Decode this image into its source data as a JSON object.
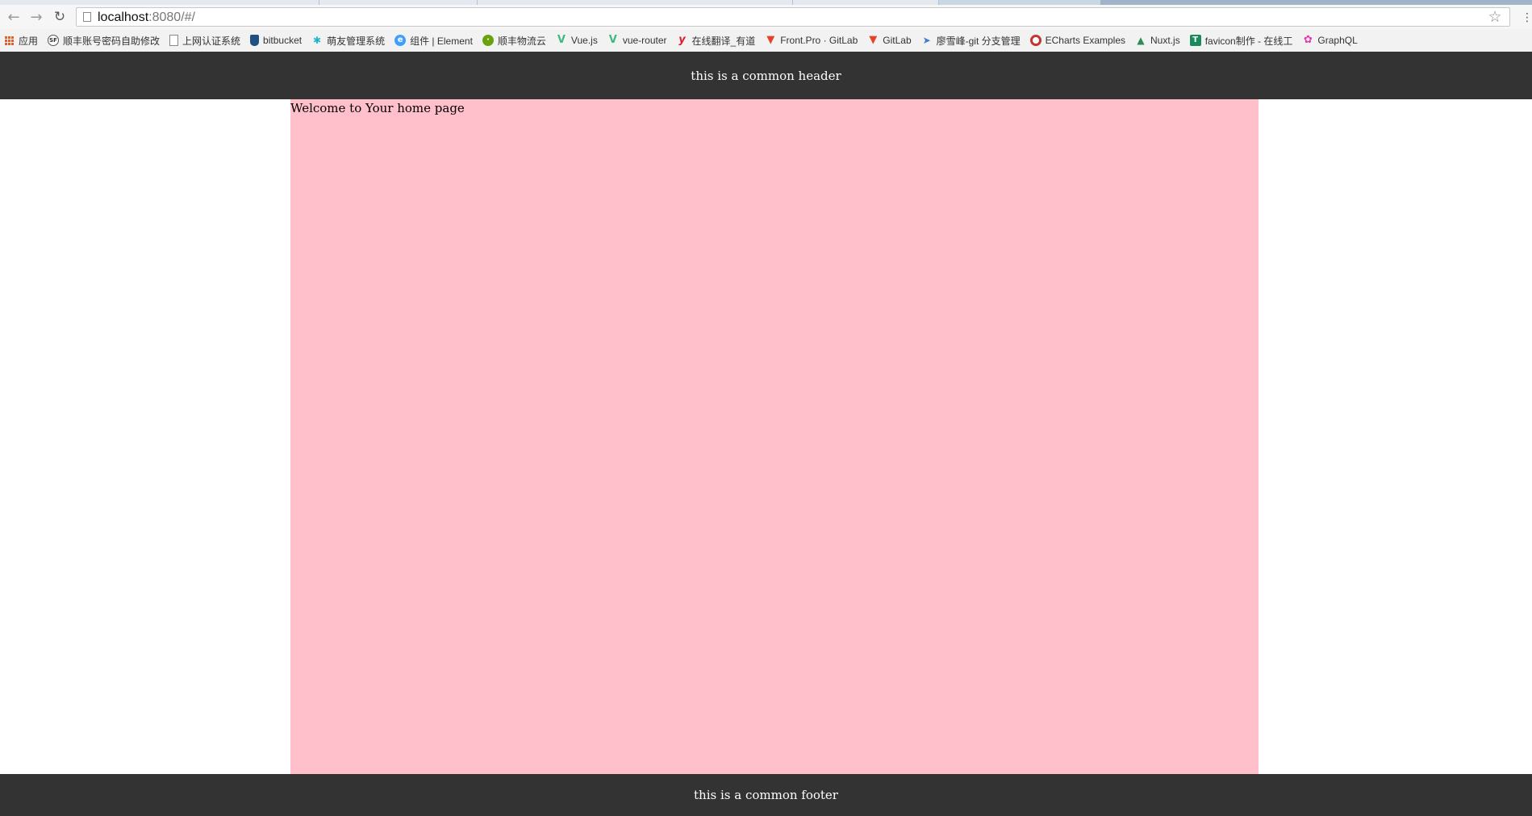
{
  "browser": {
    "back_icon": "arrow-left-icon",
    "forward_icon": "arrow-right-icon",
    "reload_icon": "reload-icon",
    "url_host": "localhost",
    "url_rest": ":8080/#/",
    "bookmark_star_icon": "star-icon",
    "menu_icon": "menu-icon"
  },
  "bookmarks": [
    {
      "label": "应用",
      "icon": "apps-grid-icon"
    },
    {
      "label": "顺丰账号密码自助修改",
      "icon": "sf-icon"
    },
    {
      "label": "上网认证系统",
      "icon": "page-icon"
    },
    {
      "label": "bitbucket",
      "icon": "bitbucket-icon"
    },
    {
      "label": "萌友管理系统",
      "icon": "tree-icon"
    },
    {
      "label": "组件 | Element",
      "icon": "element-icon"
    },
    {
      "label": "顺丰物流云",
      "icon": "cloud-icon"
    },
    {
      "label": "Vue.js",
      "icon": "vue-icon"
    },
    {
      "label": "vue-router",
      "icon": "vue-icon"
    },
    {
      "label": "在线翻译_有道",
      "icon": "youdao-icon"
    },
    {
      "label": "Front.Pro · GitLab",
      "icon": "gitlab-icon"
    },
    {
      "label": "GitLab",
      "icon": "gitlab-icon"
    },
    {
      "label": "廖雪峰-git 分支管理",
      "icon": "rocket-icon"
    },
    {
      "label": "ECharts Examples",
      "icon": "echarts-icon"
    },
    {
      "label": "Nuxt.js",
      "icon": "nuxt-icon"
    },
    {
      "label": "favicon制作 - 在线工",
      "icon": "favicon-icon"
    },
    {
      "label": "GraphQL",
      "icon": "graphql-icon"
    }
  ],
  "colors": {
    "header_bg": "#333333",
    "main_bg": "#ffc0cb",
    "page_bg": "#ffffff"
  },
  "header": {
    "text": "this is a common header"
  },
  "main": {
    "welcome": "Welcome to Your home page"
  },
  "footer": {
    "text": "this is a common footer"
  }
}
